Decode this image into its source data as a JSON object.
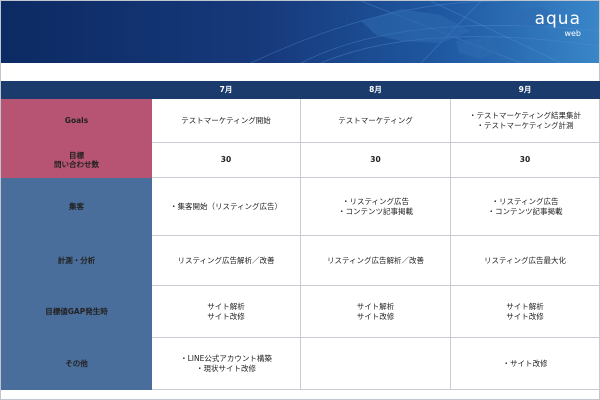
{
  "header": {
    "logo_main": "aqua",
    "logo_sub": "web"
  },
  "table": {
    "columns": [
      "7月",
      "8月",
      "9月"
    ],
    "rows": [
      {
        "label": "Goals",
        "label_color": "#b85473",
        "cells": [
          [
            "テストマーケティング開始"
          ],
          [
            "テストマーケティング"
          ],
          [
            "・テストマーケティング結果集計",
            "・テストマーケティング計測"
          ]
        ]
      },
      {
        "label": "目標 問い合わせ数",
        "label_lines": [
          "目標",
          "問い合わせ数"
        ],
        "label_color": "#b85473",
        "cells": [
          [
            "30"
          ],
          [
            "30"
          ],
          [
            "30"
          ]
        ]
      },
      {
        "label": "集客",
        "label_color": "#4a6e9b",
        "cells": [
          [
            "・集客開始（リスティング広告）"
          ],
          [
            "・リスティング広告",
            "・コンテンツ記事掲載"
          ],
          [
            "・リスティング広告",
            "・コンテンツ記事掲載"
          ]
        ]
      },
      {
        "label": "計測・分析",
        "label_color": "#4a6e9b",
        "cells": [
          [
            "リスティング広告解析／改善"
          ],
          [
            "リスティング広告解析／改善"
          ],
          [
            "リスティング広告最大化"
          ]
        ]
      },
      {
        "label": "目標値GAP発生時",
        "label_color": "#4a6e9b",
        "cells": [
          [
            "サイト解析",
            "サイト改修"
          ],
          [
            "サイト解析",
            "サイト改修"
          ],
          [
            "サイト解析",
            "サイト改修"
          ]
        ]
      },
      {
        "label": "その他",
        "label_color": "#4a6e9b",
        "cells": [
          [
            "・LINE公式アカウント構築",
            "・現状サイト改修"
          ],
          [],
          [
            "・サイト改修"
          ]
        ]
      }
    ]
  }
}
